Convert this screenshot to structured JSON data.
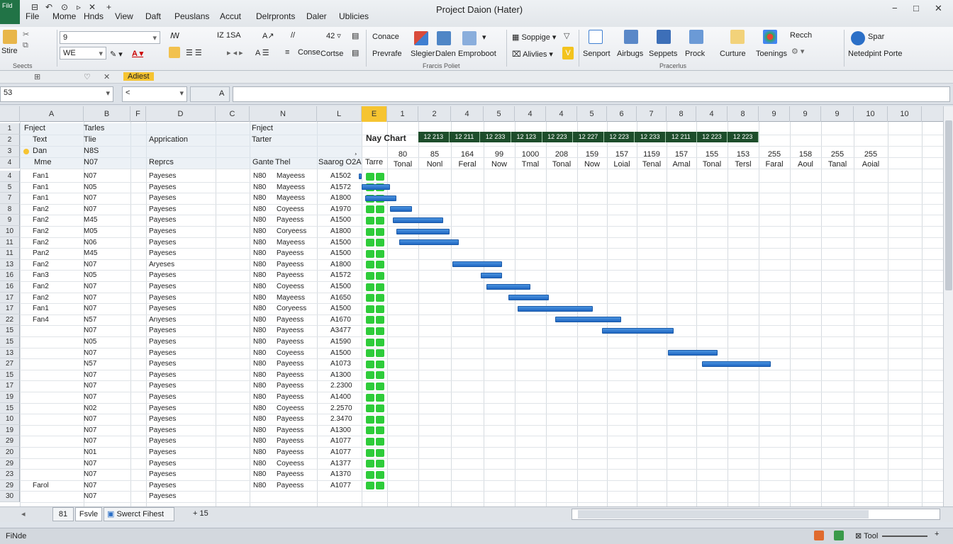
{
  "title": "Project Daion (Hater)",
  "app_icon": "Fild",
  "quick_access": [
    "⊟",
    "↶",
    "⊙",
    "▹",
    "✕",
    "+"
  ],
  "menu": [
    "File",
    "Mome",
    "Hnds",
    "View",
    "Daft",
    "Peuslans",
    "Accut",
    "Delrpronts",
    "Daler",
    "Ublicies"
  ],
  "ribbon": {
    "clipboard": {
      "paste": "Stire",
      "group": "Seects"
    },
    "font": {
      "name": "9",
      "size": "WE",
      "font_items": [
        "ꟿ",
        "IZ 1SA",
        "A↗",
        "//",
        "42 ▿"
      ],
      "format_items": [
        "Conse",
        "Cortse"
      ]
    },
    "styles": {
      "items": [
        "Conace",
        "Prevrafe",
        "Slegier",
        "Dalen",
        "Emproboot"
      ],
      "group": "Frarcis Poliet"
    },
    "cells": {
      "items": [
        "Soppige",
        "Alivlies"
      ]
    },
    "editing": {
      "items": [
        "Senport",
        "Airbugs",
        "Seppets",
        "Prock",
        "Curture",
        "Toenings"
      ],
      "group": "Pracerlus"
    },
    "extras": {
      "items": [
        "Recch",
        "Spar",
        "Netedpint Porte"
      ]
    }
  },
  "subbar": {
    "highlight": "Adiest"
  },
  "formula_bar": {
    "name_box": "53",
    "nav": "<",
    "fx": "A",
    "formula": ""
  },
  "columns": [
    "A",
    "B",
    "F",
    "D",
    "C",
    "N",
    "L",
    "E",
    "1",
    "2",
    "4",
    "5",
    "4",
    "4",
    "5",
    "6",
    "7",
    "8",
    "4",
    "8",
    "9",
    "9",
    "9",
    "10",
    "10"
  ],
  "header_rows": {
    "r1": {
      "num": "1",
      "a": "Fnject",
      "b": "Tarles",
      "n": "Fnject"
    },
    "r2": {
      "num": "2",
      "a": "Text",
      "b": "Tlie",
      "d": "Apprication",
      "n": "Tarter",
      "chart": "Nay Chart"
    },
    "r3": {
      "num": "3",
      "a": "Dan",
      "b": "N8S",
      "l": "¸"
    },
    "r4": {
      "num": "4",
      "a": "Mme",
      "b": "N07",
      "d": "Reprcs",
      "c": "Gante",
      "n": "Thel",
      "l": "Saarog O2A",
      "e": "Tarre"
    }
  },
  "timeline_labels": [
    "12 213",
    "12 211",
    "12 233",
    "12 123",
    "12 223",
    "12 227",
    "12 223",
    "12 233",
    "12 211",
    "12 223",
    "12 223"
  ],
  "timeline_values": [
    "80",
    "85",
    "164",
    "99",
    "1000",
    "208",
    "159",
    "157",
    "1159",
    "157",
    "155",
    "153",
    "255",
    "158",
    "255",
    "255"
  ],
  "timeline_units": [
    "Tonal",
    "Nonl",
    "Feral",
    "Now",
    "Tmal",
    "Tonal",
    "Now",
    "Loial",
    "Tenal",
    "Amal",
    "Tonal",
    "Tersl",
    "Faral",
    "Aoul",
    "Tanal",
    "Aoial"
  ],
  "rows": [
    {
      "num": "4",
      "a": "Fan1",
      "b": "N07",
      "d": "Payeses",
      "c": "N80",
      "n": "Mayeess",
      "l": "A1502",
      "start": 0,
      "end": 0.1
    },
    {
      "num": "5",
      "a": "Fan1",
      "b": "N05",
      "d": "Payeses",
      "c": "N80",
      "n": "Mayeess",
      "l": "A1572",
      "start": 0.1,
      "end": 1.0
    },
    {
      "num": "7",
      "a": "Fan1",
      "b": "N07",
      "d": "Payeses",
      "c": "N80",
      "n": "Mayeess",
      "l": "A1800",
      "start": 0.2,
      "end": 1.2
    },
    {
      "num": "8",
      "a": "Fan2",
      "b": "N07",
      "d": "Payeses",
      "c": "N80",
      "n": "Coyeess",
      "l": "A1970",
      "start": 1.0,
      "end": 1.7
    },
    {
      "num": "9",
      "a": "Fan2",
      "b": "M45",
      "d": "Payeses",
      "c": "N80",
      "n": "Payeess",
      "l": "A1500",
      "start": 1.1,
      "end": 2.7
    },
    {
      "num": "10",
      "a": "Fan2",
      "b": "M05",
      "d": "Payeses",
      "c": "N80",
      "n": "Coryeess",
      "l": "A1800",
      "start": 1.2,
      "end": 2.9
    },
    {
      "num": "11",
      "a": "Fan2",
      "b": "N06",
      "d": "Payeses",
      "c": "N80",
      "n": "Mayeess",
      "l": "A1500",
      "start": 1.3,
      "end": 3.2
    },
    {
      "num": "11",
      "a": "Pan2",
      "b": "M45",
      "d": "Payeses",
      "c": "N80",
      "n": "Payeess",
      "l": "A1500",
      "start": null,
      "end": null
    },
    {
      "num": "13",
      "a": "Fan2",
      "b": "N07",
      "d": "Aryeses",
      "c": "N80",
      "n": "Payeess",
      "l": "A1800",
      "start": 3.0,
      "end": 4.6
    },
    {
      "num": "16",
      "a": "Fan3",
      "b": "N05",
      "d": "Payeses",
      "c": "N80",
      "n": "Payeess",
      "l": "A1572",
      "start": 3.9,
      "end": 4.6
    },
    {
      "num": "16",
      "a": "Fan2",
      "b": "N07",
      "d": "Payeses",
      "c": "N80",
      "n": "Coyeess",
      "l": "A1500",
      "start": 4.1,
      "end": 5.5
    },
    {
      "num": "17",
      "a": "Fan2",
      "b": "N07",
      "d": "Payeses",
      "c": "N80",
      "n": "Mayeess",
      "l": "A1650",
      "start": 4.8,
      "end": 6.1
    },
    {
      "num": "17",
      "a": "Fan1",
      "b": "N07",
      "d": "Payeses",
      "c": "N80",
      "n": "Coryeess",
      "l": "A1500",
      "start": 5.1,
      "end": 7.5
    },
    {
      "num": "22",
      "a": "Fan4",
      "b": "N57",
      "d": "Anyeses",
      "c": "N80",
      "n": "Payeess",
      "l": "A1670",
      "start": 6.3,
      "end": 8.4
    },
    {
      "num": "15",
      "a": "",
      "b": "N07",
      "d": "Payeses",
      "c": "N80",
      "n": "Payeess",
      "l": "A3477",
      "start": 7.8,
      "end": 10.1
    },
    {
      "num": "15",
      "a": "",
      "b": "N05",
      "d": "Payeses",
      "c": "N80",
      "n": "Payeess",
      "l": "A1590",
      "start": null,
      "end": null
    },
    {
      "num": "13",
      "a": "",
      "b": "N07",
      "d": "Payeses",
      "c": "N80",
      "n": "Coyeess",
      "l": "A1500",
      "start": 9.9,
      "end": 11.5
    },
    {
      "num": "27",
      "a": "",
      "b": "N57",
      "d": "Payeses",
      "c": "N80",
      "n": "Payeess",
      "l": "A1073",
      "start": 11.0,
      "end": 13.2
    },
    {
      "num": "15",
      "a": "",
      "b": "N07",
      "d": "Payeses",
      "c": "N80",
      "n": "Payeess",
      "l": "A1300",
      "start": null,
      "end": null
    },
    {
      "num": "17",
      "a": "",
      "b": "N07",
      "d": "Payeses",
      "c": "N80",
      "n": "Payeess",
      "l": "2.2300",
      "start": null,
      "end": null
    },
    {
      "num": "19",
      "a": "",
      "b": "N07",
      "d": "Payeses",
      "c": "N80",
      "n": "Payeess",
      "l": "A1400",
      "start": null,
      "end": null
    },
    {
      "num": "15",
      "a": "",
      "b": "N02",
      "d": "Payeses",
      "c": "N80",
      "n": "Coyeess",
      "l": "2.2570",
      "start": null,
      "end": null
    },
    {
      "num": "10",
      "a": "",
      "b": "N07",
      "d": "Payeses",
      "c": "N80",
      "n": "Payeess",
      "l": "2.3470",
      "start": null,
      "end": null
    },
    {
      "num": "19",
      "a": "",
      "b": "N07",
      "d": "Payeses",
      "c": "N80",
      "n": "Payeess",
      "l": "A1300",
      "start": null,
      "end": null
    },
    {
      "num": "29",
      "a": "",
      "b": "N07",
      "d": "Payeses",
      "c": "N80",
      "n": "Payeess",
      "l": "A1077",
      "start": null,
      "end": null
    },
    {
      "num": "20",
      "a": "",
      "b": "N01",
      "d": "Payeses",
      "c": "N80",
      "n": "Payeess",
      "l": "A1077",
      "start": null,
      "end": null
    },
    {
      "num": "29",
      "a": "",
      "b": "N07",
      "d": "Payeses",
      "c": "N80",
      "n": "Coyeess",
      "l": "A1377",
      "start": null,
      "end": null
    },
    {
      "num": "23",
      "a": "",
      "b": "N07",
      "d": "Payeses",
      "c": "N80",
      "n": "Payeess",
      "l": "A1370",
      "start": null,
      "end": null
    },
    {
      "num": "29",
      "a": "Farol",
      "b": "N07",
      "d": "Payeses",
      "c": "N80",
      "n": "Payeess",
      "l": "A1077",
      "start": null,
      "end": null
    },
    {
      "num": "30",
      "a": "",
      "b": "N07",
      "d": "Payeses",
      "c": "",
      "n": "",
      "l": "",
      "start": null,
      "end": null
    }
  ],
  "sheet_tabs": [
    "81",
    "Fsvle",
    "Swerct",
    "Fihest"
  ],
  "sheet_extra": "+ 15",
  "status": {
    "left": "FiNde",
    "zoom_label": "Tool"
  },
  "colors": {
    "bar": "#2f7fd6",
    "done": "#2ecc3a",
    "header_strip": "#1d4d2b",
    "accent": "#217346"
  }
}
